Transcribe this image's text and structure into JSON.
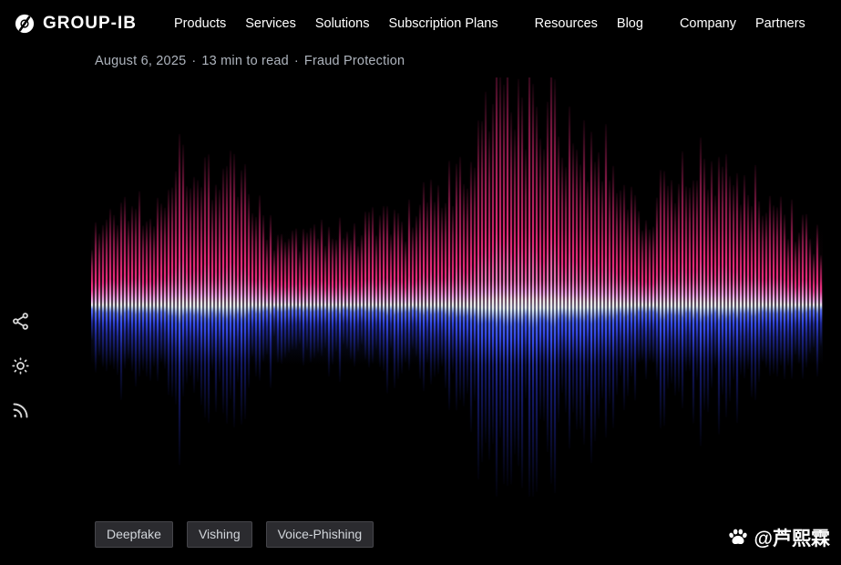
{
  "header": {
    "brand": "GROUP-IB",
    "nav": [
      "Products",
      "Services",
      "Solutions",
      "Subscription Plans",
      "Resources",
      "Blog",
      "Company",
      "Partners"
    ]
  },
  "article": {
    "date": "August 6, 2025",
    "read_time": "13 min to read",
    "category": "Fraud Protection",
    "separator": "·"
  },
  "hero": {
    "description": "audio-waveform-visualization",
    "colors": {
      "pink": "#ff2e86",
      "pink_bright": "#ff9ad2",
      "pink_core": "#ffd9ec",
      "blue": "#3d55ff",
      "blue_core": "#c3cdff",
      "blue_deep": "#1b2390",
      "background": "#000000"
    }
  },
  "sidebar": {
    "icons": [
      "share",
      "brightness",
      "rss"
    ]
  },
  "tags": [
    "Deepfake",
    "Vishing",
    "Voice-Phishing"
  ],
  "watermark": {
    "handle": "@芦熙霖",
    "icon": "paw"
  }
}
